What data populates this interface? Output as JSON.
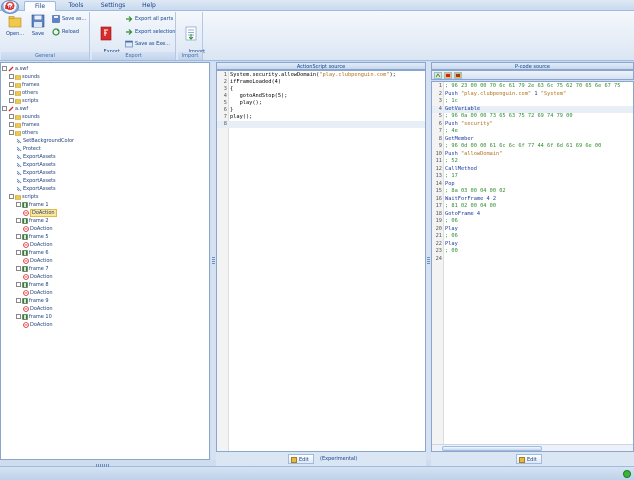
{
  "app_button_label": "DEC",
  "tabs": [
    "File",
    "Tools",
    "Settings",
    "Help"
  ],
  "ribbon": {
    "general": {
      "label": "General",
      "open": "Open...",
      "save": "Save",
      "save_as": "Save as...",
      "reload": "Reload"
    },
    "export": {
      "label": "Export",
      "export_fla": "Export\nto FLA",
      "export_all": "Export all parts",
      "export_selection": "Export selection",
      "save_as_exe": "Save as Exe..."
    },
    "import": {
      "label": "Import",
      "import_text": "Import\ntext"
    }
  },
  "tree": [
    {
      "label": "a.swf",
      "depth": 0,
      "icon": "swf-icon"
    },
    {
      "label": "sounds",
      "depth": 1,
      "icon": "folder-icon"
    },
    {
      "label": "frames",
      "depth": 1,
      "icon": "folder-icon"
    },
    {
      "label": "others",
      "depth": 1,
      "icon": "folder-icon"
    },
    {
      "label": "scripts",
      "depth": 1,
      "icon": "folder-icon"
    },
    {
      "label": "a.swf",
      "depth": 0,
      "icon": "swf-icon"
    },
    {
      "label": "sounds",
      "depth": 1,
      "icon": "folder-icon"
    },
    {
      "label": "frames",
      "depth": 1,
      "icon": "folder-icon"
    },
    {
      "label": "others",
      "depth": 1,
      "icon": "folder-icon"
    },
    {
      "label": "SetBackgroundColor",
      "depth": 2,
      "icon": "tag-icon"
    },
    {
      "label": "Protect",
      "depth": 2,
      "icon": "tag-icon"
    },
    {
      "label": "ExportAssets",
      "depth": 2,
      "icon": "tag-icon"
    },
    {
      "label": "ExportAssets",
      "depth": 2,
      "icon": "tag-icon"
    },
    {
      "label": "ExportAssets",
      "depth": 2,
      "icon": "tag-icon"
    },
    {
      "label": "ExportAssets",
      "depth": 2,
      "icon": "tag-icon"
    },
    {
      "label": "ExportAssets",
      "depth": 2,
      "icon": "tag-icon"
    },
    {
      "label": "scripts",
      "depth": 1,
      "icon": "folder-icon"
    },
    {
      "label": "frame 1",
      "depth": 2,
      "icon": "frame-icon"
    },
    {
      "label": "DoAction",
      "depth": 3,
      "icon": "action-icon",
      "selected": true
    },
    {
      "label": "frame 2",
      "depth": 2,
      "icon": "frame-icon"
    },
    {
      "label": "DoAction",
      "depth": 3,
      "icon": "action-icon"
    },
    {
      "label": "frame 5",
      "depth": 2,
      "icon": "frame-icon"
    },
    {
      "label": "DoAction",
      "depth": 3,
      "icon": "action-icon"
    },
    {
      "label": "frame 6",
      "depth": 2,
      "icon": "frame-icon"
    },
    {
      "label": "DoAction",
      "depth": 3,
      "icon": "action-icon"
    },
    {
      "label": "frame 7",
      "depth": 2,
      "icon": "frame-icon"
    },
    {
      "label": "DoAction",
      "depth": 3,
      "icon": "action-icon"
    },
    {
      "label": "frame 8",
      "depth": 2,
      "icon": "frame-icon"
    },
    {
      "label": "DoAction",
      "depth": 3,
      "icon": "action-icon"
    },
    {
      "label": "frame 9",
      "depth": 2,
      "icon": "frame-icon"
    },
    {
      "label": "DoAction",
      "depth": 3,
      "icon": "action-icon"
    },
    {
      "label": "frame 10",
      "depth": 2,
      "icon": "frame-icon"
    },
    {
      "label": "DoAction",
      "depth": 3,
      "icon": "action-icon"
    }
  ],
  "as_panel": {
    "title": "ActionScript source",
    "lines": [
      [
        "System.security.allowDomain(",
        "\"play.clubpenguin.com\"",
        ");"
      ],
      [
        "ifFrameLoaded(4)",
        "",
        ""
      ],
      [
        "{",
        "",
        ""
      ],
      [
        "   gotoAndStop(5);",
        "",
        ""
      ],
      [
        "   play();",
        "",
        ""
      ],
      [
        "}",
        "",
        ""
      ],
      [
        "play();",
        "",
        ""
      ],
      [
        "",
        "",
        ""
      ]
    ],
    "current_line": 8,
    "edit_label": "Edit",
    "experimental_label": "(Experimental)"
  },
  "pcode_panel": {
    "title": "P-code source",
    "lines": [
      [
        "comment",
        "; 96 23 00 00 70 6c 61 79 2e 63 6c 75 62 70 65 6e 67 75"
      ],
      [
        "mixed",
        "Push ",
        "\"play.clubpenguin.com\"",
        " 1 ",
        "\"System\""
      ],
      [
        "comment",
        "; 1c"
      ],
      [
        "op",
        "GetVariable"
      ],
      [
        "comment",
        "; 96 0a 00 00 73 65 63 75 72 69 74 79 00"
      ],
      [
        "mixed",
        "Push ",
        "\"security\"",
        "",
        ""
      ],
      [
        "comment",
        "; 4e"
      ],
      [
        "op",
        "GetMember"
      ],
      [
        "comment",
        "; 96 0d 00 00 61 6c 6c 6f 77 44 6f 6d 61 69 6e 00"
      ],
      [
        "mixed",
        "Push ",
        "\"allowDomain\"",
        "",
        ""
      ],
      [
        "comment",
        "; 52"
      ],
      [
        "op",
        "CallMethod"
      ],
      [
        "comment",
        "; 17"
      ],
      [
        "op",
        "Pop"
      ],
      [
        "comment",
        "; 8a 03 00 04 00 02"
      ],
      [
        "op",
        "WaitForFrame 4 2"
      ],
      [
        "comment",
        "; 81 02 00 04 00"
      ],
      [
        "op",
        "GotoFrame 4"
      ],
      [
        "comment",
        "; 06"
      ],
      [
        "op",
        "Play"
      ],
      [
        "comment",
        "; 06"
      ],
      [
        "op",
        "Play"
      ],
      [
        "comment",
        "; 00"
      ],
      [
        "op",
        ""
      ]
    ],
    "current_line": 4,
    "edit_label": "Edit"
  },
  "colors": {
    "accent": "#15428b",
    "panel_border": "#8aa6cf",
    "selection": "#fbe79a",
    "pcode_comment": "#2e8b2e",
    "string": "#b0701a"
  }
}
